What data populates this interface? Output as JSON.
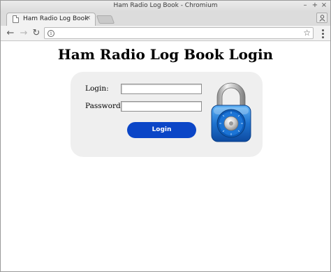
{
  "window": {
    "title": "Ham Radio Log Book - Chromium",
    "controls": {
      "minimize": "–",
      "maximize": "+",
      "close": "×"
    }
  },
  "tabs": [
    {
      "title": "Ham Radio Log Book",
      "close_glyph": "×"
    }
  ],
  "toolbar": {
    "back_glyph": "←",
    "forward_glyph": "→",
    "reload_glyph": "↻",
    "url": "",
    "info_glyph": "i",
    "star_glyph": "☆"
  },
  "page": {
    "heading": "Ham Radio Log Book Login",
    "form": {
      "login_label": "Login:",
      "login_value": "",
      "password_label": "Password:",
      "password_value": "",
      "submit_label": "Login"
    },
    "colors": {
      "panel_bg": "#efefef",
      "button_bg": "#0b46c7",
      "padlock_dial": "#1a6fd1"
    },
    "icons": [
      "padlock-icon"
    ]
  }
}
